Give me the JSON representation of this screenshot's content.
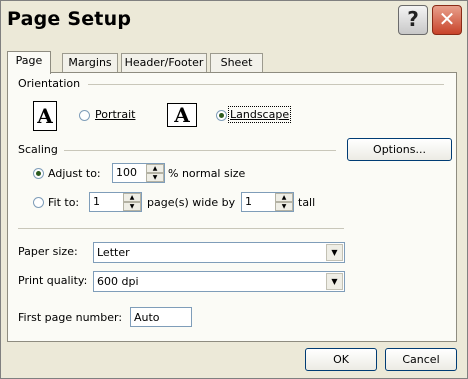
{
  "window": {
    "title": "Page Setup",
    "help_glyph": "?",
    "close_glyph": "✕"
  },
  "tabs": [
    {
      "label": "Page",
      "active": true
    },
    {
      "label": "Margins",
      "active": false
    },
    {
      "label": "Header/Footer",
      "active": false
    },
    {
      "label": "Sheet",
      "active": false
    }
  ],
  "orientation": {
    "label": "Orientation",
    "portrait_icon": "A",
    "portrait_label": "Portrait",
    "landscape_icon": "A",
    "landscape_label": "Landscape",
    "selected": "landscape"
  },
  "scaling": {
    "label": "Scaling",
    "adjust_to_label": "Adjust to:",
    "adjust_value": "100",
    "adjust_suffix": "% normal size",
    "fit_to_label": "Fit to:",
    "fit_wide_value": "1",
    "fit_wide_suffix": "page(s) wide by",
    "fit_tall_value": "1",
    "fit_tall_suffix": "tall",
    "selected": "adjust"
  },
  "options_button": "Options...",
  "paper_size": {
    "label": "Paper size:",
    "value": "Letter"
  },
  "print_quality": {
    "label": "Print quality:",
    "value": "600 dpi"
  },
  "first_page_number": {
    "label": "First page number:",
    "value": "Auto"
  },
  "footer": {
    "ok": "OK",
    "cancel": "Cancel"
  },
  "colors": {
    "face": "#ece9d8",
    "panel": "#fbfbf6",
    "close": "#c8432a"
  }
}
